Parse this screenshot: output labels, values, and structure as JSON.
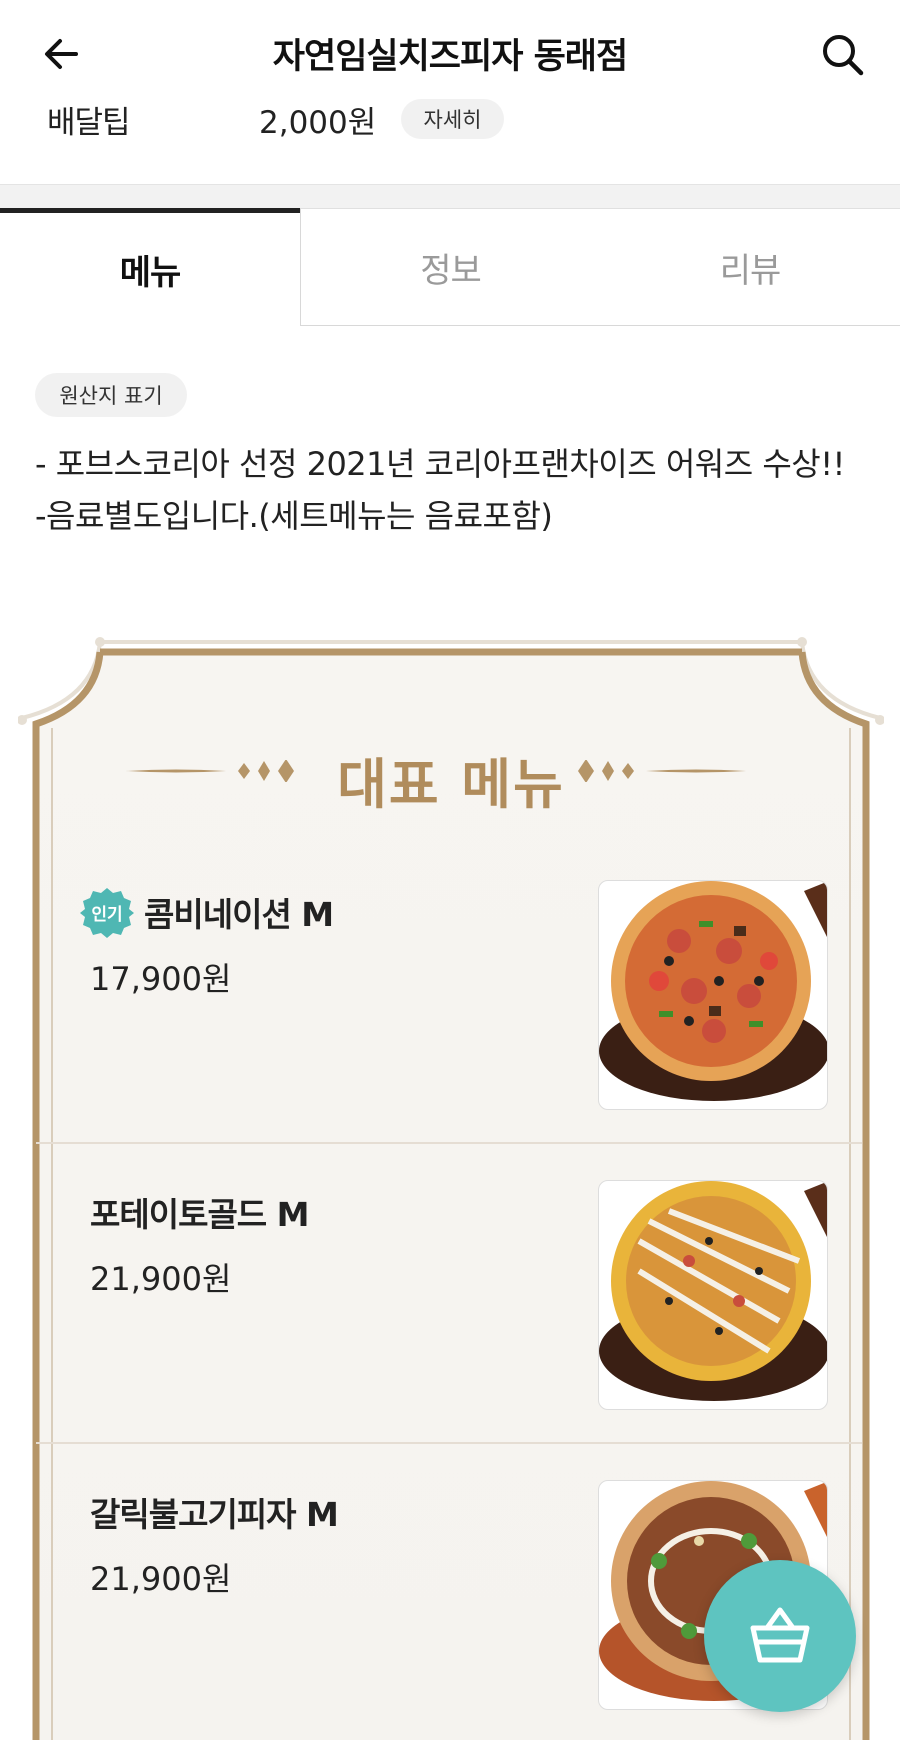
{
  "header": {
    "title": "자연임실치즈피자 동래점",
    "back_icon": "arrow-left-icon",
    "search_icon": "search-icon"
  },
  "delivery": {
    "label": "배달팁",
    "fee": "2,000원",
    "detail_label": "자세히"
  },
  "tabs": [
    {
      "label": "메뉴",
      "active": true
    },
    {
      "label": "정보",
      "active": false
    },
    {
      "label": "리뷰",
      "active": false
    }
  ],
  "notice": {
    "origin_label": "원산지 표기",
    "line1": "- 포브스코리아 선정 2021년 코리아프랜차이즈 어워즈 수상!!",
    "line2": "-음료별도입니다.(세트메뉴는 음료포함)"
  },
  "featured": {
    "title": "대표 메뉴",
    "items": [
      {
        "name": "콤비네이션 M",
        "price": "17,900원",
        "badge": "인기"
      },
      {
        "name": "포테이토골드 M",
        "price": "21,900원",
        "badge": ""
      },
      {
        "name": "갈릭불고기피자 M",
        "price": "21,900원",
        "badge": ""
      }
    ]
  },
  "cart": {
    "icon": "shopping-basket-icon"
  },
  "colors": {
    "accent_gold": "#b08c5c",
    "cart_teal": "#5ec4c0",
    "badge_teal": "#4fb7b3"
  }
}
